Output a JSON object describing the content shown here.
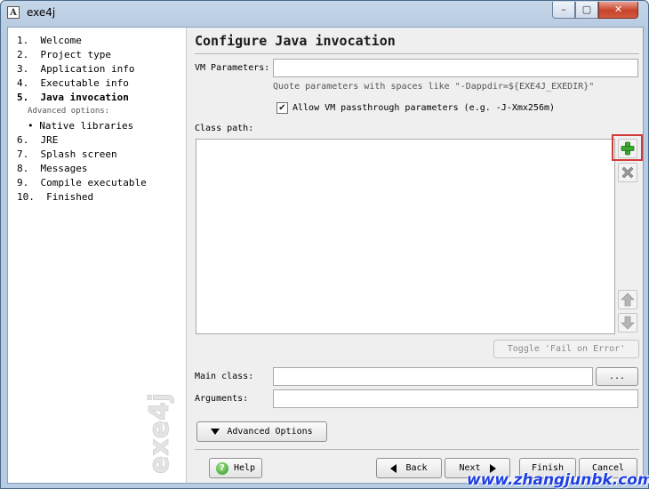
{
  "window": {
    "title": "exe4j",
    "icon_label": "A",
    "controls": {
      "minimize": "–",
      "maximize": "▢",
      "close": "✕"
    }
  },
  "sidebar": {
    "steps": [
      {
        "label": "1.  Welcome",
        "active": false
      },
      {
        "label": "2.  Project type",
        "active": false
      },
      {
        "label": "3.  Application info",
        "active": false
      },
      {
        "label": "4.  Executable info",
        "active": false
      },
      {
        "label": "5.  Java invocation",
        "active": true
      },
      {
        "label": "6.  JRE",
        "active": false
      },
      {
        "label": "7.  Splash screen",
        "active": false
      },
      {
        "label": "8.  Messages",
        "active": false
      },
      {
        "label": "9.  Compile executable",
        "active": false
      },
      {
        "label": "10.  Finished",
        "active": false
      }
    ],
    "advanced_label": "Advanced options:",
    "advanced_item": "• Native libraries",
    "watermark": "exe4j"
  },
  "page": {
    "title": "Configure Java invocation",
    "vm_parameters_label": "VM Parameters:",
    "vm_parameters_value": "",
    "hint": "Quote parameters with spaces like \"-Dappdir=${EXE4J_EXEDIR}\"",
    "passthrough_checked": true,
    "passthrough_label": "Allow VM passthrough parameters (e.g. -J-Xmx256m)",
    "class_path_label": "Class path:",
    "class_path_entries": [],
    "toggle_button": "Toggle 'Fail on Error'",
    "main_class_label": "Main class:",
    "main_class_value": "",
    "browse_button": "...",
    "arguments_label": "Arguments:",
    "arguments_value": "",
    "advanced_options_button": "Advanced Options"
  },
  "footer": {
    "help": "Help",
    "back": "Back",
    "next": "Next",
    "finish": "Finish",
    "cancel": "Cancel"
  },
  "overlay": {
    "site_watermark": "www.zhangjunbk.com"
  },
  "icons": {
    "add": "plus-icon",
    "remove": "x-icon",
    "up": "arrow-up-icon",
    "down": "arrow-down-icon"
  },
  "colors": {
    "add_icon": "#3aa82c",
    "highlight_border": "#d23a3a",
    "watermark_link": "#1f3fe0"
  }
}
